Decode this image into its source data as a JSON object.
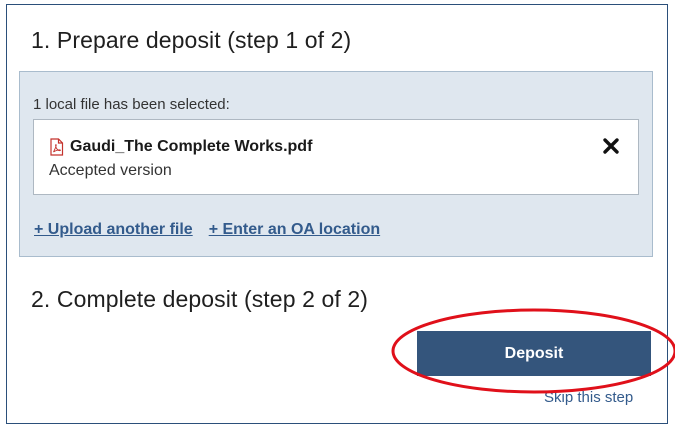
{
  "step1": {
    "heading": "1. Prepare deposit (step 1 of 2)",
    "selected_text": "1 local file has been selected:",
    "file": {
      "name": "Gaudi_The Complete Works.pdf",
      "version": "Accepted version",
      "icon": "pdf-file-icon",
      "remove_icon": "close-icon"
    },
    "links": {
      "upload_another": "+ Upload another file",
      "enter_oa_location": "+ Enter an OA location"
    }
  },
  "step2": {
    "heading": "2. Complete deposit (step 2 of 2)",
    "deposit_label": "Deposit",
    "skip_label": "Skip this step"
  },
  "colors": {
    "accent": "#34557c",
    "link": "#335b8c",
    "file_box_bg": "#dfe7ef",
    "highlight": "#e0101a"
  }
}
